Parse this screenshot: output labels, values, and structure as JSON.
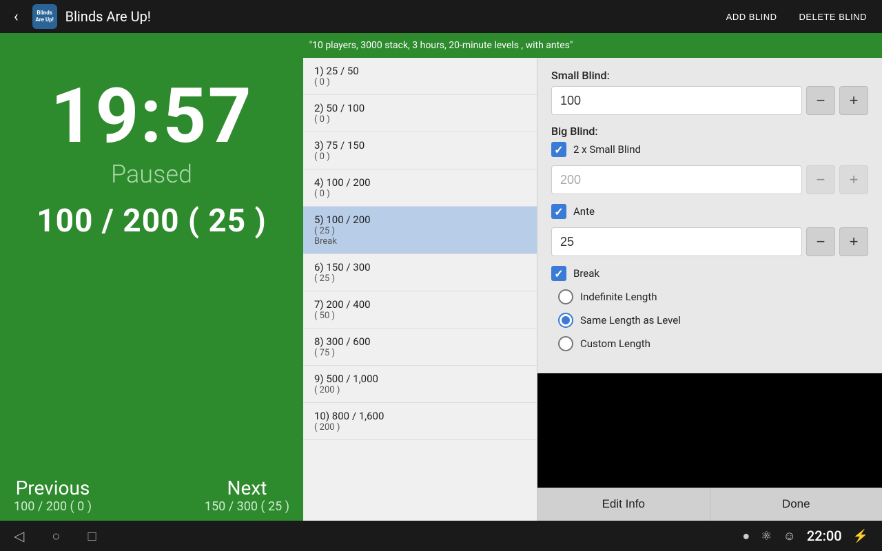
{
  "app": {
    "icon_text": "Blinds\nAre\nUp!",
    "title": "Blinds Are Up!",
    "btn_add_blind": "ADD BLIND",
    "btn_delete_blind": "DELETE BLIND"
  },
  "subtitle": "\"10 players, 3000 stack, 3 hours, 20-minute levels , with antes\"",
  "sidebar_info": "10 players, 3000 stack, 3 hours, 20-minute levels , with antes",
  "timer": {
    "display": "19:57",
    "status": "Paused",
    "current_blind": "100 / 200  ( 25 )",
    "previous_label": "Previous",
    "previous_value": "100 / 200  ( 0 )",
    "next_label": "Next",
    "next_value": "150 / 300  ( 25 )"
  },
  "blind_levels": [
    {
      "num": "1)",
      "title": "25 / 50",
      "sub": "( 0 )"
    },
    {
      "num": "2)",
      "title": "50 / 100",
      "sub": "( 0 )"
    },
    {
      "num": "3)",
      "title": "75 / 150",
      "sub": "( 0 )"
    },
    {
      "num": "4)",
      "title": "100 / 200",
      "sub": "( 0 )"
    },
    {
      "num": "5)",
      "title": "100 / 200",
      "sub": "( 25 )",
      "extra": "Break",
      "selected": true
    },
    {
      "num": "6)",
      "title": "150 / 300",
      "sub": "( 25 )"
    },
    {
      "num": "7)",
      "title": "200 / 400",
      "sub": "( 50 )"
    },
    {
      "num": "8)",
      "title": "300 / 600",
      "sub": "( 75 )"
    },
    {
      "num": "9)",
      "title": "500 / 1,000",
      "sub": "( 200 )"
    },
    {
      "num": "10)",
      "title": "800 / 1,600",
      "sub": "( 200 )"
    }
  ],
  "edit_panel": {
    "small_blind_label": "Small Blind:",
    "small_blind_value": "100",
    "big_blind_label": "Big Blind:",
    "big_blind_checked": true,
    "big_blind_checkbox_label": "2 x Small Blind",
    "big_blind_value": "200",
    "ante_checked": true,
    "ante_checkbox_label": "Ante",
    "ante_value": "25",
    "break_checked": true,
    "break_checkbox_label": "Break",
    "break_options": [
      {
        "label": "Indefinite Length",
        "selected": false
      },
      {
        "label": "Same Length as Level",
        "selected": true
      },
      {
        "label": "Custom Length",
        "selected": false
      }
    ],
    "btn_edit_info": "Edit Info",
    "btn_done": "Done"
  },
  "android_nav": {
    "clock": "22:00",
    "back_icon": "◁",
    "home_icon": "○",
    "recent_icon": "□"
  }
}
